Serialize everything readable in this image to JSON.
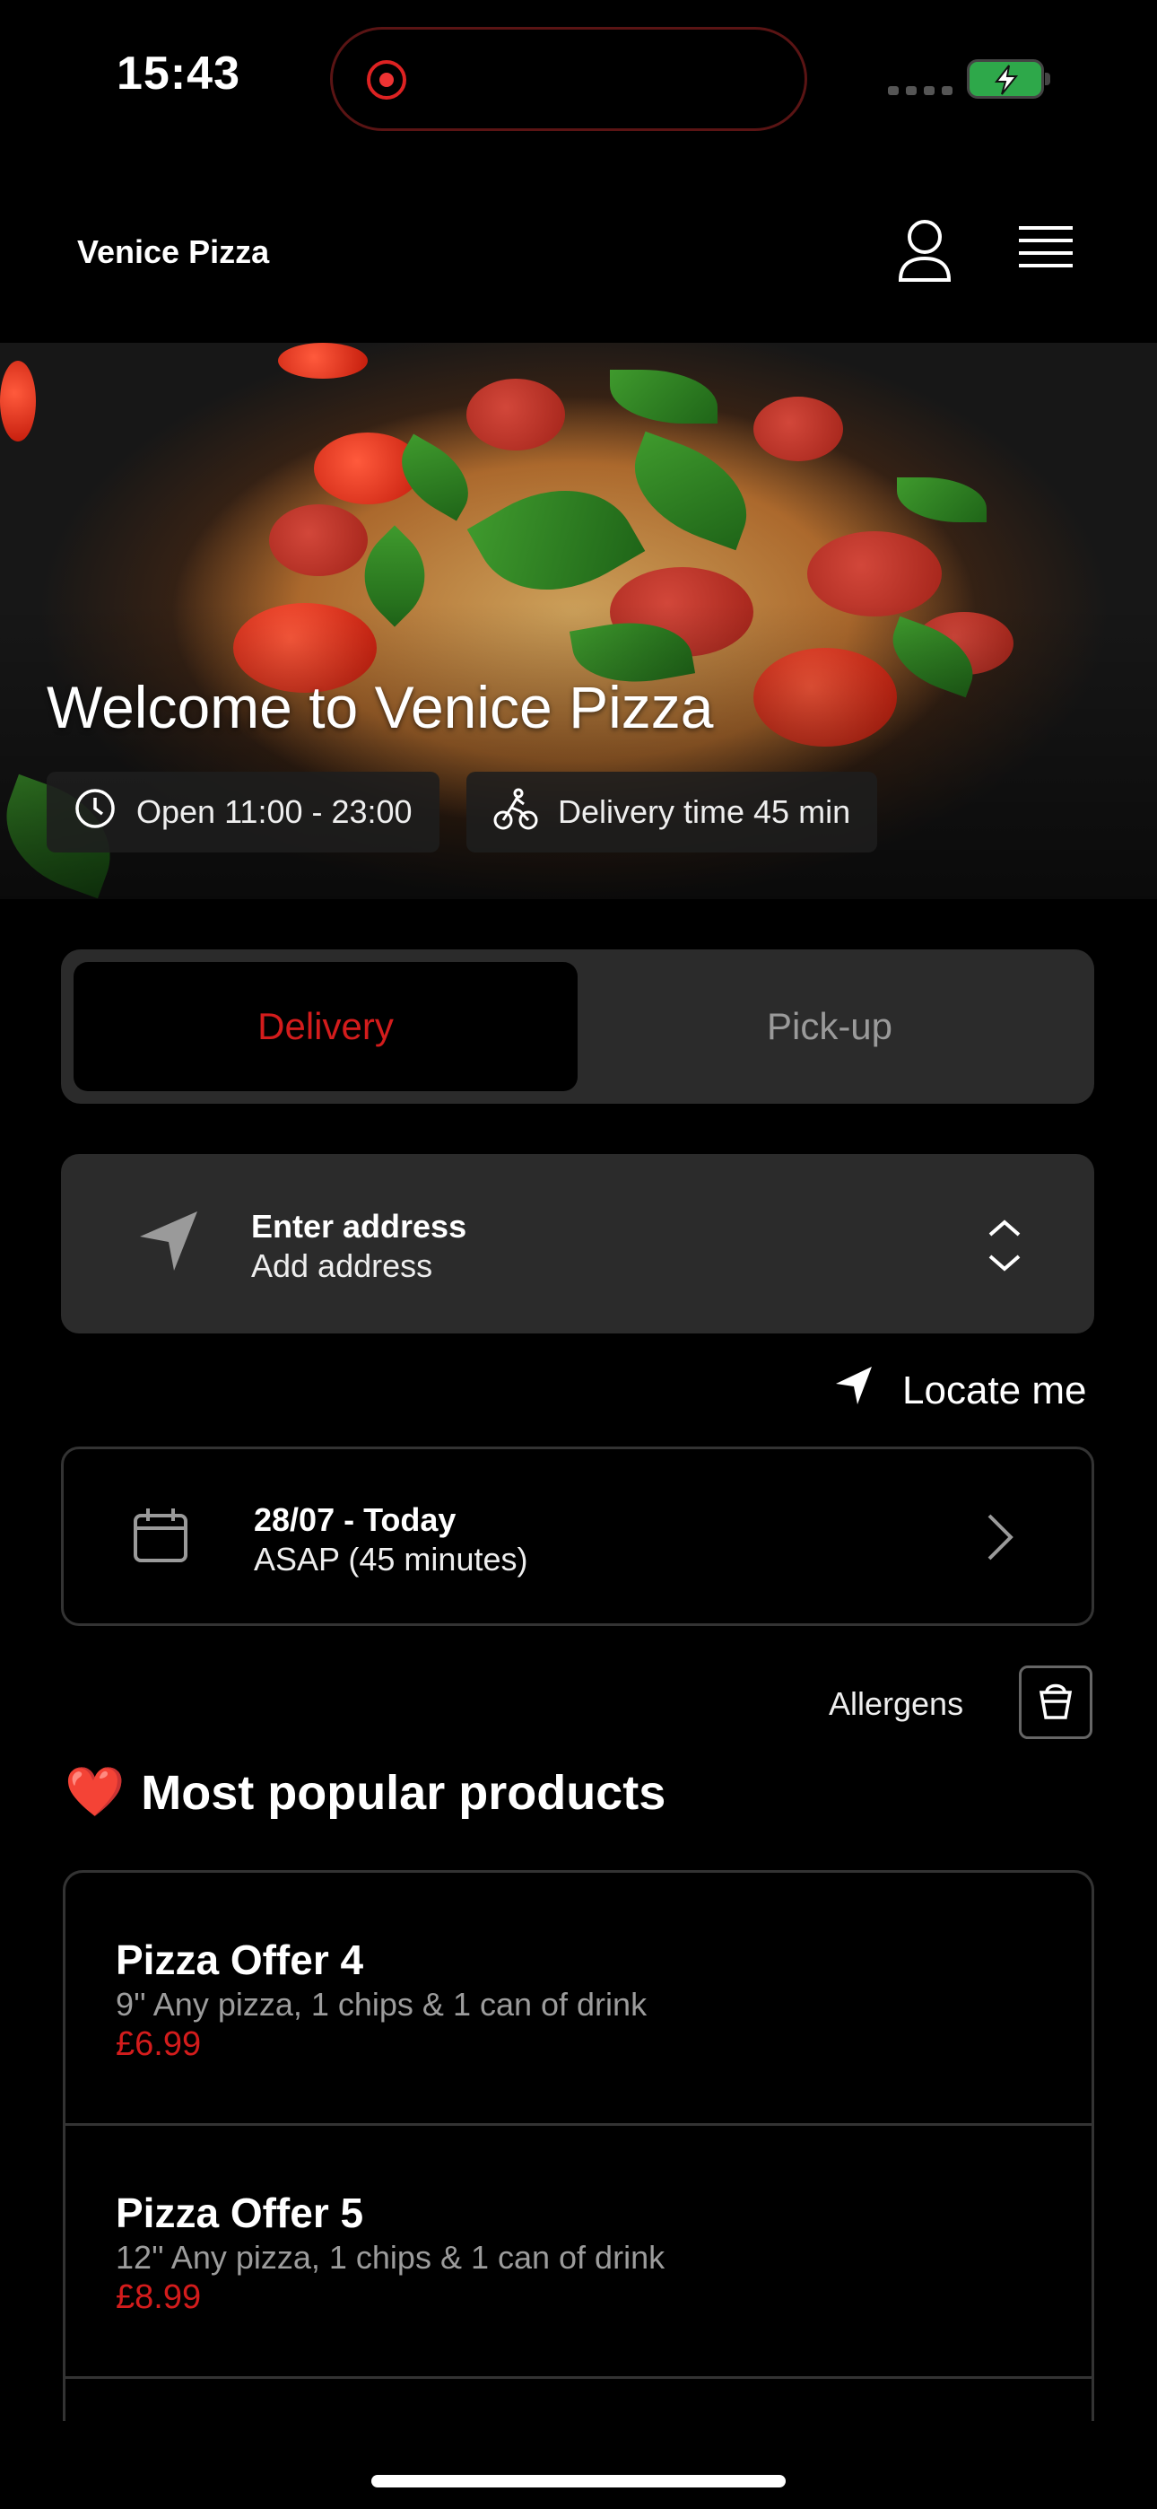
{
  "status_bar": {
    "time": "15:43"
  },
  "header": {
    "brand": "Venice Pizza"
  },
  "hero": {
    "title": "Welcome to Venice Pizza",
    "hours_chip": "Open 11:00 - 23:00",
    "delivery_chip": "Delivery time 45 min"
  },
  "order_mode": {
    "delivery": "Delivery",
    "pickup": "Pick-up",
    "selected": "Delivery"
  },
  "address": {
    "title": "Enter address",
    "subtitle": "Add address"
  },
  "locate_me": "Locate me",
  "schedule": {
    "date": "28/07 - Today",
    "time": "ASAP (45 minutes)"
  },
  "allergens_label": "Allergens",
  "popular": {
    "emoji": "❤️",
    "title": "Most popular products",
    "items": [
      {
        "name": "Pizza Offer 4",
        "description": "9'' Any pizza, 1 chips & 1 can of drink",
        "price": "£6.99"
      },
      {
        "name": "Pizza Offer 5",
        "description": "12'' Any pizza, 1 chips & 1 can of drink",
        "price": "£8.99"
      }
    ]
  },
  "colors": {
    "accent": "#d31c1c",
    "card_bg": "#2b2b2b",
    "background": "#000000"
  },
  "icons": [
    "record-icon",
    "battery-icon",
    "user-icon",
    "menu-icon",
    "clock-icon",
    "bike-icon",
    "navigation-arrow-icon",
    "chevron-up-down-icon",
    "calendar-icon",
    "chevron-right-icon",
    "allergens-icon",
    "heart-emoji"
  ]
}
